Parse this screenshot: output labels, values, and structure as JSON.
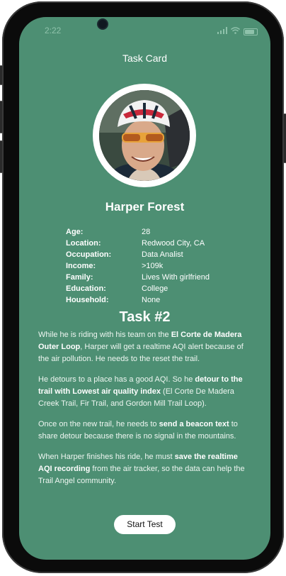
{
  "status_bar": {
    "time": "2:22"
  },
  "header": {
    "title": "Task Card"
  },
  "persona": {
    "name": "Harper Forest",
    "attributes": [
      {
        "label": "Age:",
        "value": "28"
      },
      {
        "label": "Location:",
        "value": "Redwood City, CA"
      },
      {
        "label": "Occupation:",
        "value": "Data Analist"
      },
      {
        "label": "Income:",
        "value": ">109k"
      },
      {
        "label": "Family:",
        "value": "Lives With girlfriend"
      },
      {
        "label": "Education:",
        "value": "College"
      },
      {
        "label": "Household:",
        "value": "None"
      }
    ]
  },
  "task": {
    "title": "Task #2",
    "paragraphs": [
      {
        "p1": "While he is riding with his team on the ",
        "b1": "El Corte de Madera Outer Loop",
        "p2": ", Harper will get a realtime AQI alert because of the air pollution. He needs to the reset the trail."
      },
      {
        "p1": "He detours to a place has a good AQI. So he ",
        "b1": "detour to the trail with Lowest air quality index",
        "p2": " (El Corte De Madera Creek Trail, Fir Trail, and Gordon Mill Trail Loop)."
      },
      {
        "p1": "Once on the new trail, he needs to ",
        "b1": "send a beacon text",
        "p2": " to share detour because there is no signal in the mountains."
      },
      {
        "p1": "When Harper finishes his ride, he must ",
        "b1": "save the realtime AQI recording",
        "p2": " from the air tracker, so the data can help the Trail Angel community."
      }
    ]
  },
  "actions": {
    "start_label": "Start Test"
  },
  "colors": {
    "background": "#4d8f73",
    "text": "#ffffff",
    "button_bg": "#ffffff",
    "button_text": "#111111"
  }
}
